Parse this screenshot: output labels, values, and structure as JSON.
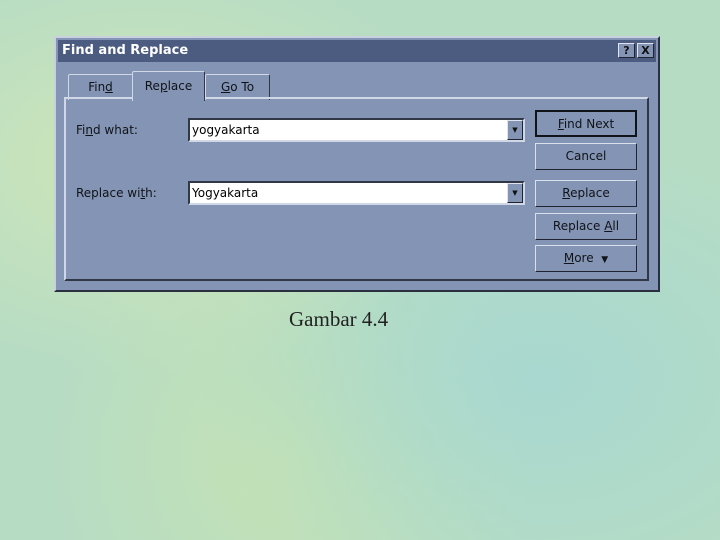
{
  "dialog": {
    "title": "Find and Replace",
    "help_label": "?",
    "close_label": "X"
  },
  "tabs": [
    {
      "pre": "Fin",
      "key": "d",
      "post": ""
    },
    {
      "pre": "Re",
      "key": "p",
      "post": "lace"
    },
    {
      "pre": "",
      "key": "G",
      "post": "o To"
    }
  ],
  "active_tab": "Replace",
  "find": {
    "pre": "Fi",
    "key": "n",
    "post": "d what:",
    "value": "yogyakarta"
  },
  "replace": {
    "pre": "Replace wi",
    "key": "t",
    "post": "h:",
    "value": "Yogyakarta"
  },
  "buttons": {
    "find_next": {
      "pre": "",
      "key": "F",
      "post": "ind Next"
    },
    "cancel": {
      "pre": "Cancel",
      "key": "",
      "post": ""
    },
    "replace": {
      "pre": "",
      "key": "R",
      "post": "eplace"
    },
    "replace_all": {
      "pre": "Replace ",
      "key": "A",
      "post": "ll"
    },
    "more": {
      "pre": "",
      "key": "M",
      "post": "ore",
      "icon": "▼"
    }
  },
  "caption": "Gambar 4.4"
}
